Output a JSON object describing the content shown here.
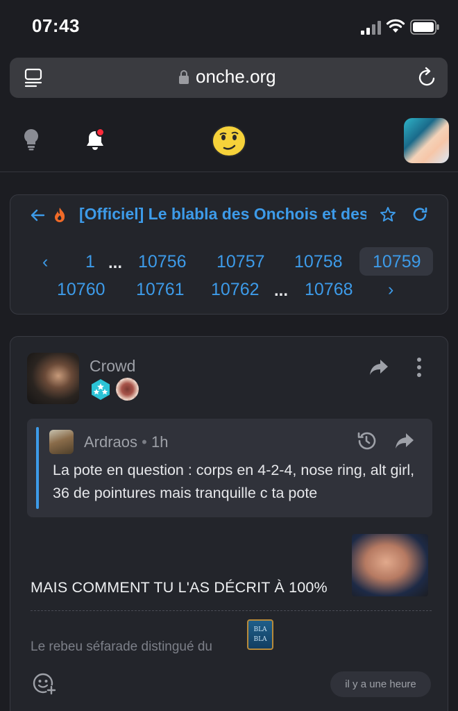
{
  "status_bar": {
    "time": "07:43"
  },
  "browser": {
    "url": "onche.org"
  },
  "topic": {
    "title": "[Officiel] Le blabla des Onchois et des",
    "pagination": {
      "prev": "‹",
      "next": "›",
      "first": "1",
      "ellipsis": "...",
      "pages_row1": [
        "10756",
        "10757",
        "10758",
        "10759"
      ],
      "pages_row2": [
        "10760",
        "10761",
        "10762"
      ],
      "last": "10768",
      "current": "10759"
    }
  },
  "post": {
    "author": "Crowd",
    "quote": {
      "author": "Ardraos",
      "separator": "•",
      "time": "1h",
      "text": "La pote en question : corps en 4-2-4, nose ring, alt girl, 36 de pointures mais tranquille c ta pote"
    },
    "body": "MAIS COMMENT TU L'AS DÉCRIT À 100%",
    "signature": "Le rebeu séfarade distingué du",
    "signature_sticker": {
      "line1": "BLA",
      "line2": "BLA"
    },
    "timestamp": "il y a une heure"
  },
  "colors": {
    "accent": "#3d9be9",
    "background": "#1c1d22",
    "card": "#23252b",
    "notification": "#ff2b3b",
    "badge": "#2bc3d6"
  }
}
